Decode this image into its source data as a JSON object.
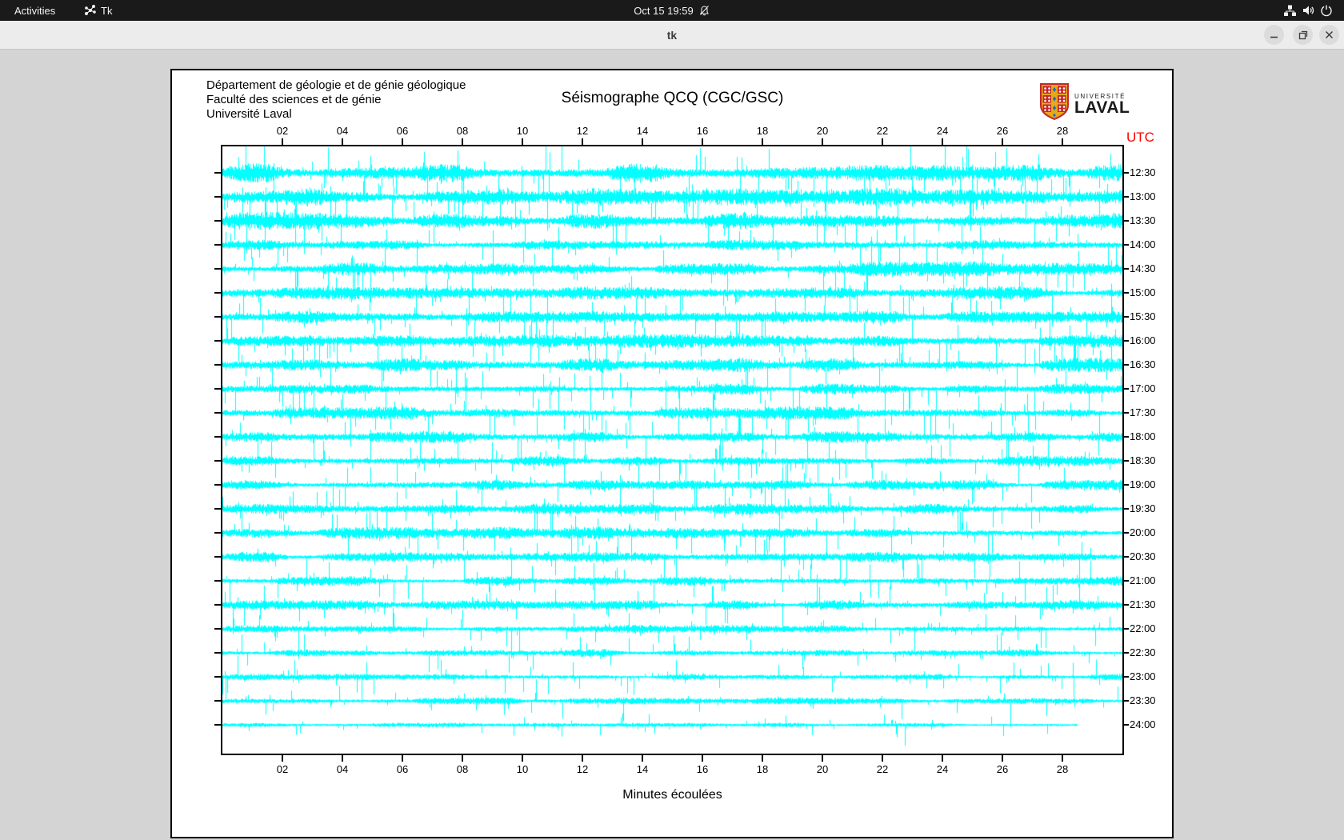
{
  "topbar": {
    "activities": "Activities",
    "app_name": "Tk",
    "clock": "Oct 15 19:59"
  },
  "titlebar": {
    "title": "tk"
  },
  "plot": {
    "header_lines": [
      "Département de géologie et de génie géologique",
      "Faculté des sciences et de génie",
      "Université Laval"
    ],
    "title": "Séismographe QCQ (CGC/GSC)",
    "utc_label": "UTC",
    "xlabel": "Minutes écoulées",
    "logo": {
      "line1": "UNIVERSITÉ",
      "line2": "LAVAL"
    },
    "colors": {
      "trace": "#00ffff",
      "utc": "#ff0000",
      "axis": "#000000"
    }
  },
  "chart_data": {
    "type": "line",
    "subtype": "seismogram-helicorder",
    "title": "Séismographe QCQ (CGC/GSC)",
    "xlabel": "Minutes écoulées",
    "x_range": [
      0,
      30
    ],
    "x_ticks": [
      "02",
      "04",
      "06",
      "08",
      "10",
      "12",
      "14",
      "16",
      "18",
      "20",
      "22",
      "24",
      "26",
      "28"
    ],
    "grid": false,
    "legend": null,
    "trace_color": "#00ffff",
    "rows": [
      {
        "label": "12:30",
        "activity": 0.95,
        "end_minute": 30
      },
      {
        "label": "13:00",
        "activity": 0.85,
        "end_minute": 30
      },
      {
        "label": "13:30",
        "activity": 0.9,
        "end_minute": 30
      },
      {
        "label": "14:00",
        "activity": 0.5,
        "end_minute": 30
      },
      {
        "label": "14:30",
        "activity": 0.75,
        "end_minute": 30
      },
      {
        "label": "15:00",
        "activity": 0.65,
        "end_minute": 30
      },
      {
        "label": "15:30",
        "activity": 0.6,
        "end_minute": 30
      },
      {
        "label": "16:00",
        "activity": 0.65,
        "end_minute": 30
      },
      {
        "label": "16:30",
        "activity": 0.7,
        "end_minute": 30
      },
      {
        "label": "17:00",
        "activity": 0.6,
        "end_minute": 30
      },
      {
        "label": "17:30",
        "activity": 0.65,
        "end_minute": 30
      },
      {
        "label": "18:00",
        "activity": 0.6,
        "end_minute": 30
      },
      {
        "label": "18:30",
        "activity": 0.5,
        "end_minute": 30
      },
      {
        "label": "19:00",
        "activity": 0.5,
        "end_minute": 30
      },
      {
        "label": "19:30",
        "activity": 0.6,
        "end_minute": 30
      },
      {
        "label": "20:00",
        "activity": 0.6,
        "end_minute": 30
      },
      {
        "label": "20:30",
        "activity": 0.5,
        "end_minute": 30
      },
      {
        "label": "21:00",
        "activity": 0.45,
        "end_minute": 30
      },
      {
        "label": "21:30",
        "activity": 0.45,
        "end_minute": 30
      },
      {
        "label": "22:00",
        "activity": 0.4,
        "end_minute": 30
      },
      {
        "label": "22:30",
        "activity": 0.35,
        "end_minute": 30
      },
      {
        "label": "23:00",
        "activity": 0.3,
        "end_minute": 30
      },
      {
        "label": "23:30",
        "activity": 0.3,
        "end_minute": 30
      },
      {
        "label": "24:00",
        "activity": 0.12,
        "end_minute": 28.5
      }
    ]
  }
}
